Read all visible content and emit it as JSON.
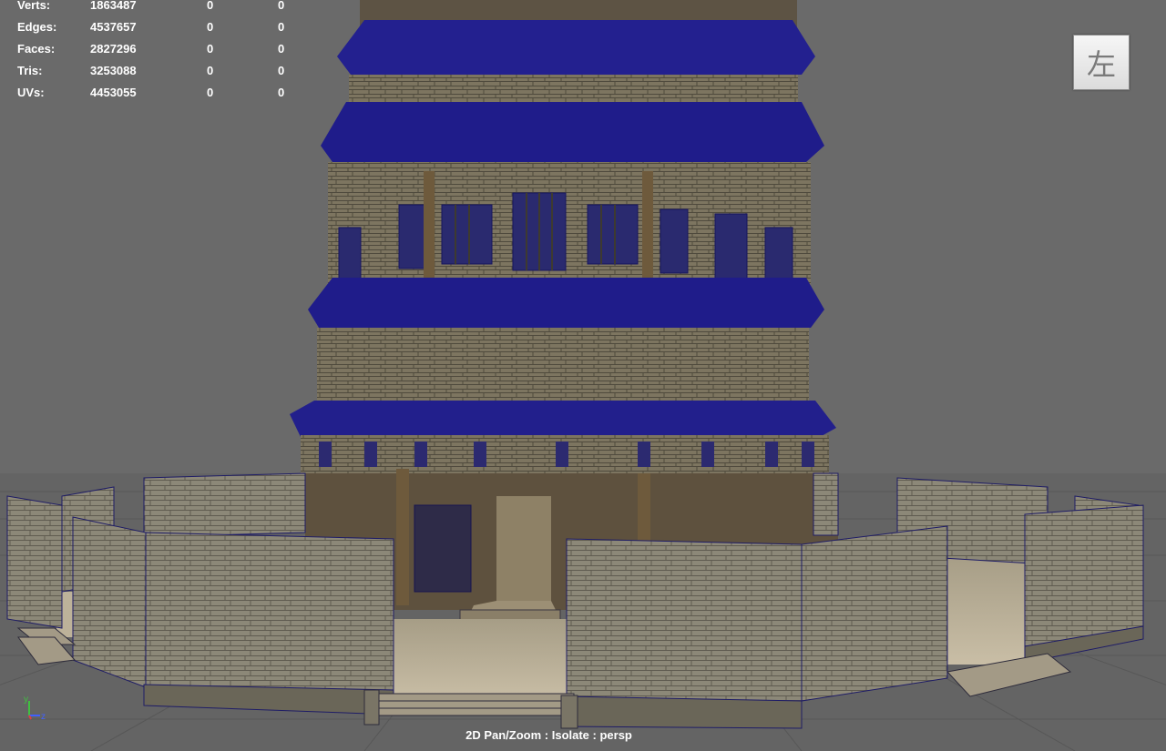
{
  "hud": {
    "rows": [
      {
        "label": "Verts:",
        "value": "1863487",
        "sel": "0",
        "comp": "0"
      },
      {
        "label": "Edges:",
        "value": "4537657",
        "sel": "0",
        "comp": "0"
      },
      {
        "label": "Faces:",
        "value": "2827296",
        "sel": "0",
        "comp": "0"
      },
      {
        "label": "Tris:",
        "value": "3253088",
        "sel": "0",
        "comp": "0"
      },
      {
        "label": "UVs:",
        "value": "4453055",
        "sel": "0",
        "comp": "0"
      }
    ]
  },
  "view_cube": {
    "face_label": "左"
  },
  "status": {
    "text": "2D Pan/Zoom : Isolate : persp"
  },
  "axis": {
    "y": "y",
    "z": "z"
  },
  "colors": {
    "background": "#6a6a6a",
    "wireframe": "#1c1a8c",
    "stone": "#8b8574",
    "wood": "#6e5a3c",
    "floor": "#bdb29a"
  }
}
